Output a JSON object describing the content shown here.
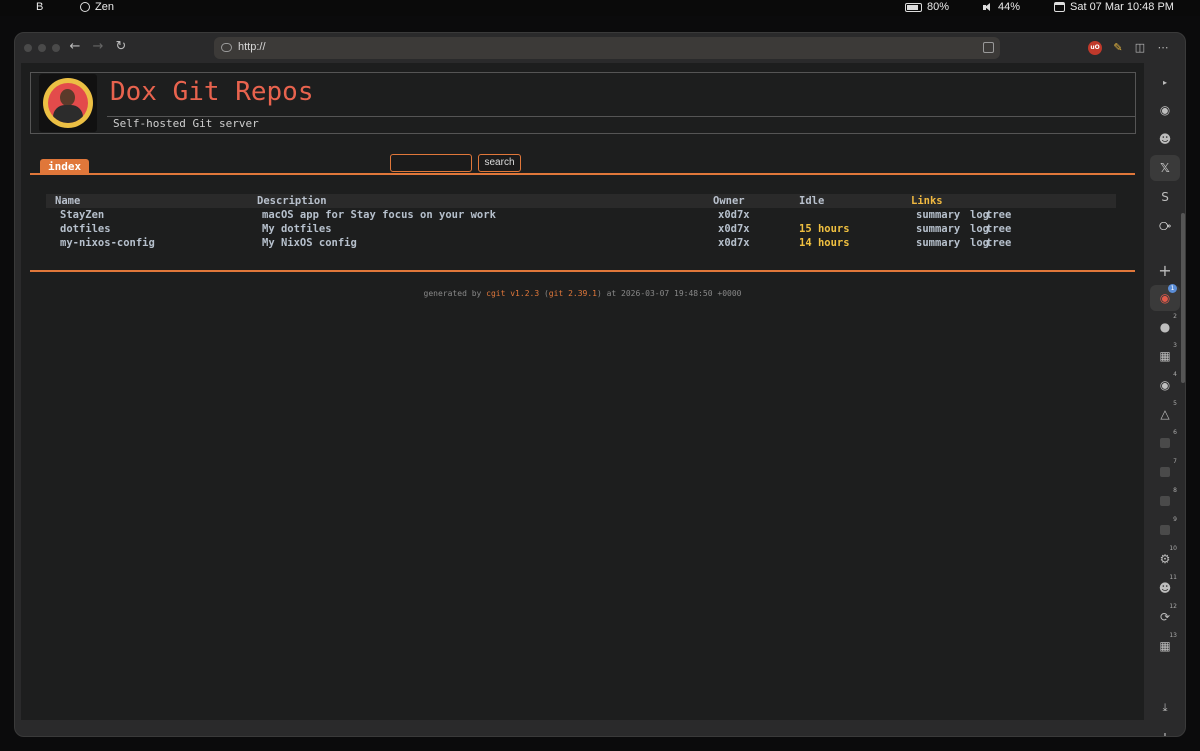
{
  "menubar": {
    "app_letter": "B",
    "app_name": "Zen",
    "battery": "80%",
    "volume": "44%",
    "datetime": "Sat 07 Mar 10:48 PM"
  },
  "browser": {
    "url": "http://",
    "ublock_label": "uO",
    "sidebar": [
      {
        "icon": "github-icon",
        "badge": ""
      },
      {
        "icon": "reddit-icon",
        "badge": ""
      },
      {
        "icon": "x-icon",
        "badge": ""
      },
      {
        "icon": "s-icon",
        "badge": ""
      },
      {
        "icon": "compass-icon",
        "badge": ""
      },
      {
        "icon": "plus-icon",
        "badge": ""
      },
      {
        "icon": "tab-1-icon",
        "badge": "1"
      },
      {
        "icon": "tab-2-icon",
        "badge": "2"
      },
      {
        "icon": "tab-3-icon",
        "badge": "3"
      },
      {
        "icon": "tab-4-icon",
        "badge": "4"
      },
      {
        "icon": "tab-5-icon",
        "badge": "5"
      },
      {
        "icon": "tab-6-icon",
        "badge": "6"
      },
      {
        "icon": "tab-7-icon",
        "badge": "7"
      },
      {
        "icon": "tab-8-icon",
        "badge": "8"
      },
      {
        "icon": "tab-9-icon",
        "badge": "9"
      },
      {
        "icon": "tab-10-icon",
        "badge": "10"
      },
      {
        "icon": "tab-11-icon",
        "badge": "11"
      },
      {
        "icon": "tab-12-icon",
        "badge": "12"
      },
      {
        "icon": "tab-13-icon",
        "badge": "13"
      }
    ]
  },
  "page": {
    "title": "Dox Git Repos",
    "description": "Self-hosted Git server",
    "tab_index": "index",
    "search_button": "search",
    "columns": {
      "name": "Name",
      "description": "Description",
      "owner": "Owner",
      "idle": "Idle",
      "links": "Links"
    },
    "repos": [
      {
        "name": "StayZen",
        "description": "macOS app for Stay focus on your work",
        "owner": "x0d7x",
        "idle": "",
        "summary": "summary",
        "log": "log",
        "tree": "tree"
      },
      {
        "name": "dotfiles",
        "description": "My dotfiles",
        "owner": "x0d7x",
        "idle": "15 hours",
        "summary": "summary",
        "log": "log",
        "tree": "tree"
      },
      {
        "name": "my-nixos-config",
        "description": "My NixOS config",
        "owner": "x0d7x",
        "idle": "14 hours",
        "summary": "summary",
        "log": "log",
        "tree": "tree"
      }
    ],
    "footer": {
      "prefix": "generated by",
      "cgit": "cgit v1.2.3",
      "open": "(",
      "git": "git 2.39.1",
      "suffix": ") at 2026-03-07 19:48:50 +0000"
    }
  }
}
